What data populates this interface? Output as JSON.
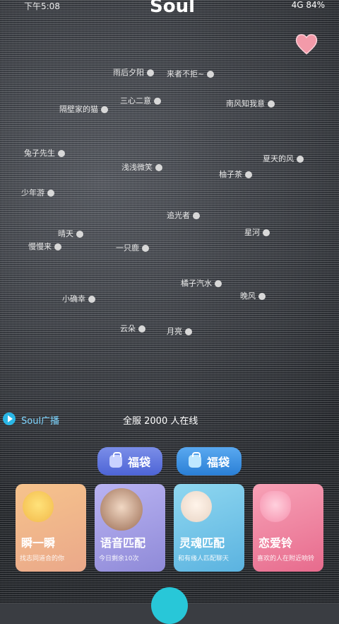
{
  "status": {
    "time": "下午5:08",
    "center": "Soul",
    "right": "4G 84%"
  },
  "users": [
    {
      "name": "雨后夕阳",
      "x": "160",
      "y": "94"
    },
    {
      "name": "来者不拒~",
      "x": "236",
      "y": "96"
    },
    {
      "name": "隔壁家的猫",
      "x": "84",
      "y": "146"
    },
    {
      "name": "南风知我意",
      "x": "320",
      "y": "138"
    },
    {
      "name": "三心二意",
      "x": "170",
      "y": "134"
    },
    {
      "name": "兔子先生",
      "x": "34",
      "y": "208"
    },
    {
      "name": "夏天的风",
      "x": "372",
      "y": "216"
    },
    {
      "name": "浅浅微笑",
      "x": "172",
      "y": "228"
    },
    {
      "name": "柚子茶",
      "x": "310",
      "y": "238"
    },
    {
      "name": "少年游",
      "x": "30",
      "y": "264"
    },
    {
      "name": "追光者",
      "x": "236",
      "y": "296"
    },
    {
      "name": "晴天",
      "x": "82",
      "y": "322"
    },
    {
      "name": "星河",
      "x": "346",
      "y": "320"
    },
    {
      "name": "慢慢来",
      "x": "40",
      "y": "340"
    },
    {
      "name": "一只鹿",
      "x": "164",
      "y": "342"
    },
    {
      "name": "橘子汽水",
      "x": "256",
      "y": "392"
    },
    {
      "name": "晚风",
      "x": "340",
      "y": "410"
    },
    {
      "name": "小确幸",
      "x": "88",
      "y": "414"
    },
    {
      "name": "云朵",
      "x": "170",
      "y": "456"
    },
    {
      "name": "月亮",
      "x": "236",
      "y": "460"
    }
  ],
  "broadcast": {
    "text1": "Soul广播",
    "text2": "全服 2000 人在线"
  },
  "fudai": [
    {
      "label": "福袋"
    },
    {
      "label": "福袋"
    }
  ],
  "cards": [
    {
      "title": "瞬一瞬",
      "subtitle": "找志同道合的你"
    },
    {
      "title": "语音匹配",
      "subtitle": "今日剩余10次"
    },
    {
      "title": "灵魂匹配",
      "subtitle": "和有缘人匹配聊天"
    },
    {
      "title": "恋爱铃",
      "subtitle": "喜欢的人在附近响铃"
    }
  ]
}
